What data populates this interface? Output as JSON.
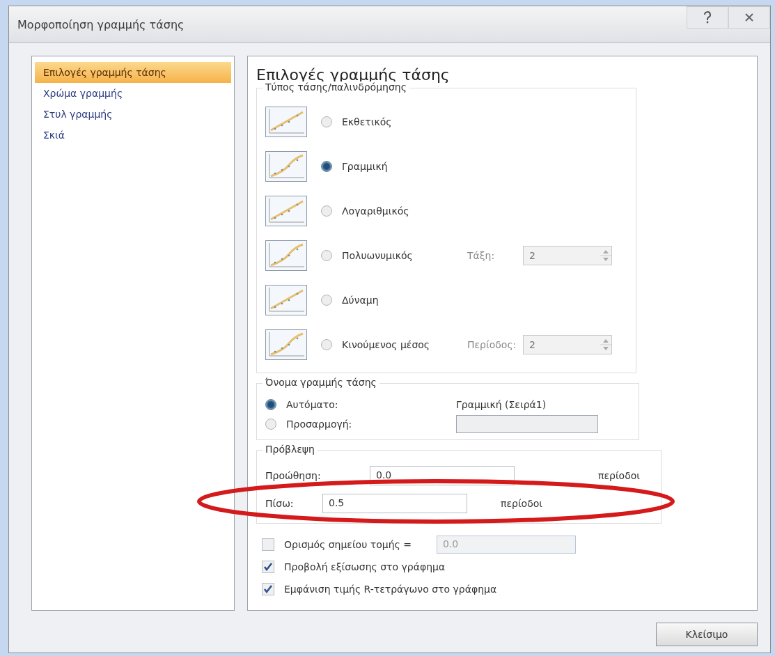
{
  "window": {
    "title": "Μορφοποίηση γραμμής τάσης"
  },
  "sidebar": {
    "items": [
      {
        "label": "Επιλογές γραμμής τάσης",
        "selected": true
      },
      {
        "label": "Χρώμα γραμμής",
        "selected": false
      },
      {
        "label": "Στυλ γραμμής",
        "selected": false
      },
      {
        "label": "Σκιά",
        "selected": false
      }
    ]
  },
  "heading": "Επιλογές γραμμής τάσης",
  "trend_type": {
    "label": "Τύπος τάσης/παλινδρόμησης",
    "options": [
      {
        "label": "Εκθετικός",
        "selected": false
      },
      {
        "label": "Γραμμική",
        "selected": true
      },
      {
        "label": "Λογαριθμικός",
        "selected": false
      },
      {
        "label": "Πολυωνυμικός",
        "selected": false,
        "extra_label": "Τάξη:",
        "extra_value": "2"
      },
      {
        "label": "Δύναμη",
        "selected": false
      },
      {
        "label": "Κινούμενος μέσος",
        "selected": false,
        "extra_label": "Περίοδος:",
        "extra_value": "2"
      }
    ]
  },
  "trend_name": {
    "label": "Όνομα γραμμής τάσης",
    "options": [
      {
        "label": "Αυτόματο:",
        "selected": true,
        "kind": "text",
        "value": "Γραμμική (Σειρά1)"
      },
      {
        "label": "Προσαρμογή:",
        "selected": false,
        "kind": "field"
      }
    ]
  },
  "forecast": {
    "label": "Πρόβλεψη",
    "rows": [
      {
        "label": "Προώθηση:",
        "value": "0.0",
        "unit": "περίοδοι",
        "highlighted": false
      },
      {
        "label": "Πίσω:",
        "value": "0.5",
        "unit": "περίοδοι",
        "highlighted": true
      }
    ]
  },
  "checkboxes": [
    {
      "label": "Ορισμός σημείου τομής =",
      "checked": false,
      "value": "0.0"
    },
    {
      "label": "Προβολή εξίσωσης στο γράφημα",
      "checked": true
    },
    {
      "label": "Εμφάνιση τιμής R-τετράγωνο στο γράφημα",
      "checked": true
    }
  ],
  "close_button": "Κλείσιμο"
}
